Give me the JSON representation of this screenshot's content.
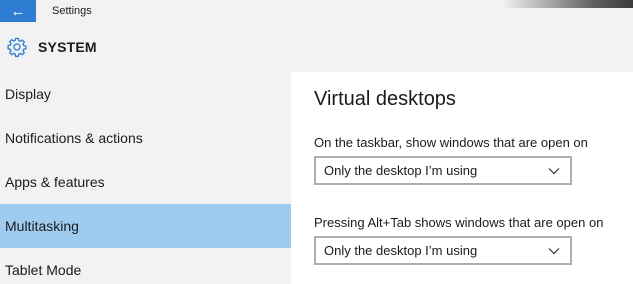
{
  "titlebar": {
    "title": "Settings",
    "back_icon": "←"
  },
  "header": {
    "title": "SYSTEM",
    "icon": "gear-icon"
  },
  "sidebar": {
    "selected_index": 3,
    "items": [
      {
        "label": "Display"
      },
      {
        "label": "Notifications & actions"
      },
      {
        "label": "Apps & features"
      },
      {
        "label": "Multitasking"
      },
      {
        "label": "Tablet Mode"
      }
    ]
  },
  "main": {
    "section_title": "Virtual desktops",
    "settings": [
      {
        "label": "On the taskbar, show windows that are open on",
        "value": "Only the desktop I’m using"
      },
      {
        "label": "Pressing Alt+Tab shows windows that are open on",
        "value": "Only the desktop I’m using"
      }
    ]
  },
  "colors": {
    "accent": "#2d7dd2",
    "selected": "#9ecbf0",
    "sidebar_bg": "#f2f2f2"
  }
}
